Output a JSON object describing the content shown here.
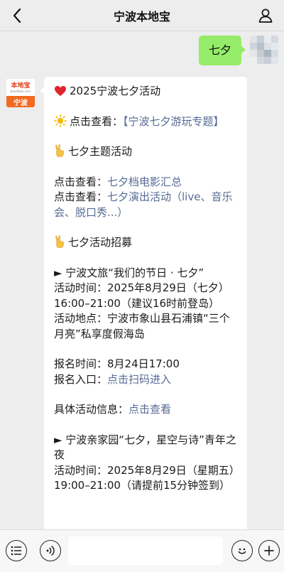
{
  "header": {
    "title": "宁波本地宝",
    "back_icon": "chevron-left-icon",
    "profile_icon": "person-icon"
  },
  "outgoing": {
    "text": "七夕",
    "bubble_color": "#95ec69"
  },
  "incoming": {
    "avatar": {
      "logo_name": "本地宝",
      "logo_url": "bendibao.com",
      "city": "宁波",
      "accent": "#f06a22"
    },
    "title": "2025宁波七夕活动",
    "line_view_prefix": "点击查看：",
    "line_view_link": "【宁波七夕游玩专题】",
    "section1_title": "七夕主题活动",
    "s1_l1_prefix": "点击查看：",
    "s1_l1_link": "七夕档电影汇总",
    "s1_l2_prefix": "点击查看：",
    "s1_l2_link": "七夕演出活动（live、音乐会、脱口秀...）",
    "section2_title": "七夕活动招募",
    "event1_title": "► 宁波文旅“我们的节日 · 七夕”",
    "event1_time": "活动时间：2025年8月29日（七夕）16:00–21:00（建议16时前登岛）",
    "event1_place": "活动地点：宁波市象山县石浦镇“三个月亮”私享度假海岛",
    "event1_signup_time": "报名时间：8月24日17:00",
    "event1_signup_prefix": "报名入口：",
    "event1_signup_link": "点击扫码进入",
    "event1_info_prefix": "具体活动信息：",
    "event1_info_link": "点击查看",
    "event2_title": "► 宁波亲家园“七夕，星空与诗”青年之夜",
    "event2_time": "活动时间：2025年8月29日（星期五）19:00–21:00（请提前15分钟签到）",
    "link_color": "#576b95"
  },
  "bottom_bar": {
    "voice_icon": "voice-icon",
    "menu_icon": "menu-list-icon",
    "emoji_icon": "emoji-icon",
    "plus_icon": "plus-icon",
    "input_value": ""
  }
}
